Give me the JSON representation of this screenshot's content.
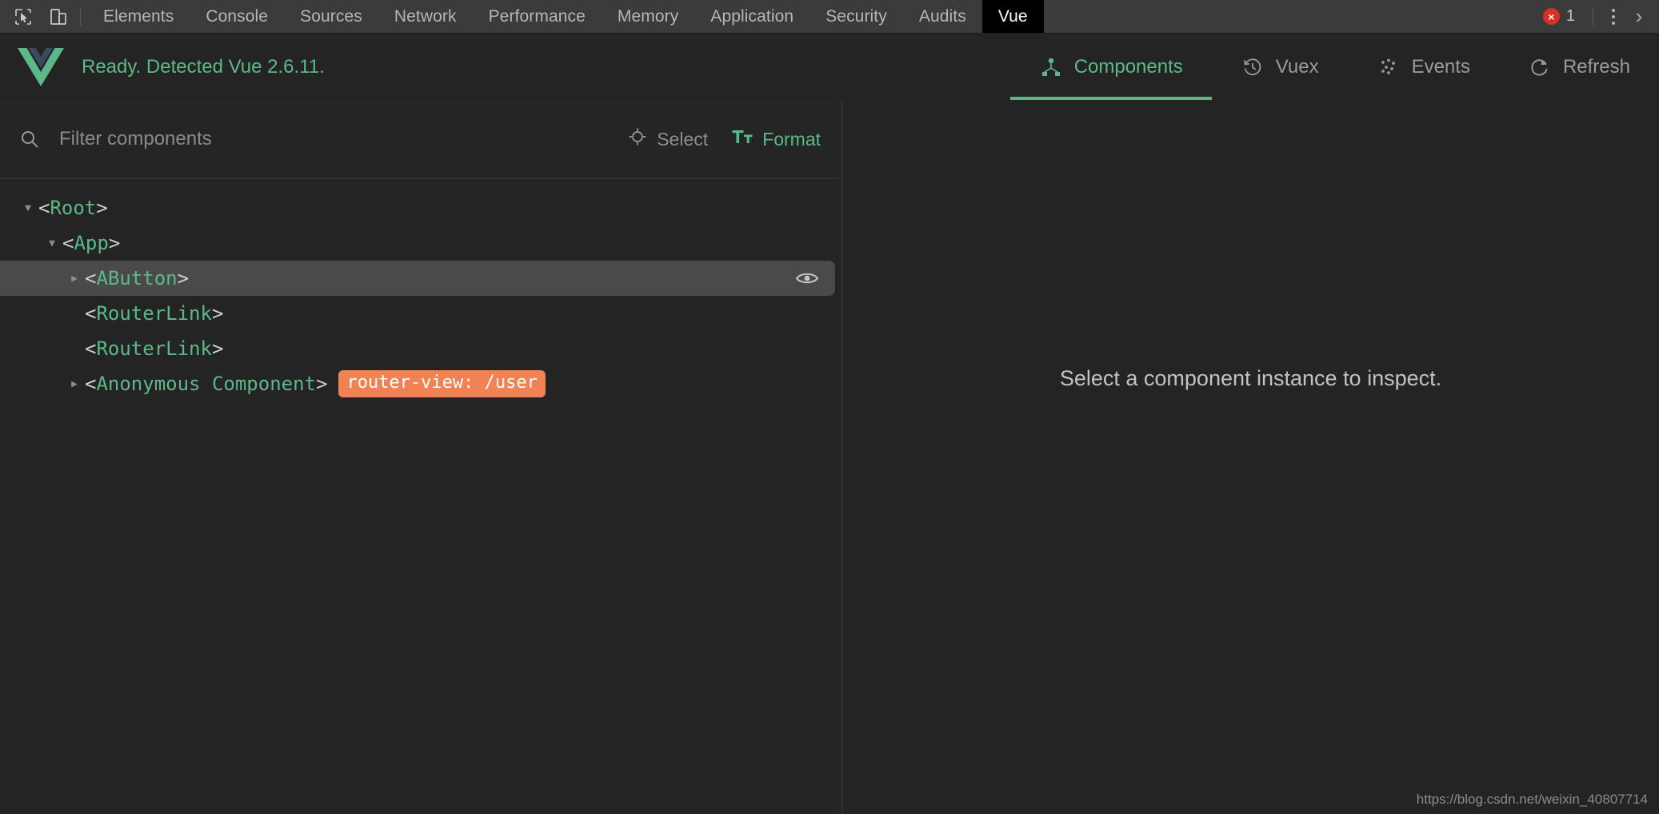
{
  "devtools": {
    "icons": [
      {
        "name": "inspect-element-icon"
      },
      {
        "name": "device-toolbar-icon"
      }
    ],
    "tabs": [
      {
        "label": "Elements",
        "active": false
      },
      {
        "label": "Console",
        "active": false
      },
      {
        "label": "Sources",
        "active": false
      },
      {
        "label": "Network",
        "active": false
      },
      {
        "label": "Performance",
        "active": false
      },
      {
        "label": "Memory",
        "active": false
      },
      {
        "label": "Application",
        "active": false
      },
      {
        "label": "Security",
        "active": false
      },
      {
        "label": "Audits",
        "active": false
      },
      {
        "label": "Vue",
        "active": true
      }
    ],
    "error_count": "1",
    "error_glyph": "×",
    "more_options_icon": "kebab-menu-icon",
    "close_chevron": "›"
  },
  "vue_panel": {
    "logo": "vue-logo-icon",
    "status": "Ready. Detected Vue 2.6.11.",
    "nav": [
      {
        "label": "Components",
        "icon": "components-tree-icon",
        "active": true
      },
      {
        "label": "Vuex",
        "icon": "history-clock-icon",
        "active": false
      },
      {
        "label": "Events",
        "icon": "events-dots-icon",
        "active": false
      },
      {
        "label": "Refresh",
        "icon": "refresh-icon",
        "active": false
      }
    ]
  },
  "filter_bar": {
    "search_icon": "search-icon",
    "placeholder": "Filter components",
    "value": "",
    "select_label": "Select",
    "select_icon": "target-crosshair-icon",
    "format_label": "Format",
    "format_icon": "text-format-icon"
  },
  "tree": {
    "rows": [
      {
        "depth": 0,
        "caret": "open",
        "open_tag": "<",
        "name": "Root",
        "close_tag": ">",
        "badge": null,
        "selected": false,
        "eye": false
      },
      {
        "depth": 1,
        "caret": "open",
        "open_tag": "<",
        "name": "App",
        "close_tag": ">",
        "badge": null,
        "selected": false,
        "eye": false
      },
      {
        "depth": 2,
        "caret": "closed",
        "open_tag": "<",
        "name": "AButton",
        "close_tag": ">",
        "badge": null,
        "selected": true,
        "eye": true
      },
      {
        "depth": 2,
        "caret": "none",
        "open_tag": "<",
        "name": "RouterLink",
        "close_tag": ">",
        "badge": null,
        "selected": false,
        "eye": false
      },
      {
        "depth": 2,
        "caret": "none",
        "open_tag": "<",
        "name": "RouterLink",
        "close_tag": ">",
        "badge": null,
        "selected": false,
        "eye": false
      },
      {
        "depth": 2,
        "caret": "closed",
        "open_tag": "<",
        "name": "Anonymous Component",
        "close_tag": ">",
        "badge": "router-view: /user",
        "selected": false,
        "eye": false
      }
    ]
  },
  "inspector": {
    "empty_message": "Select a component instance to inspect."
  },
  "watermark": "https://blog.csdn.net/weixin_40807714",
  "colors": {
    "accent_green": "#5bb989",
    "badge_orange": "#f08254",
    "error_red": "#d93025",
    "toolbar_bg": "#3b3b3b",
    "panel_bg": "#242424"
  }
}
